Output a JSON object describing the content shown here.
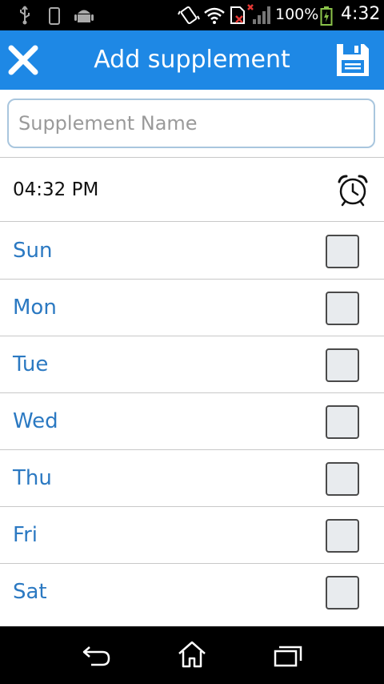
{
  "status_bar": {
    "battery": "100%",
    "time": "4:32"
  },
  "app_bar": {
    "title": "Add supplement"
  },
  "supplement_name": {
    "value": "",
    "placeholder": "Supplement Name"
  },
  "time_row": {
    "time": "04:32 PM"
  },
  "days": [
    {
      "label": "Sun",
      "checked": false
    },
    {
      "label": "Mon",
      "checked": false
    },
    {
      "label": "Tue",
      "checked": false
    },
    {
      "label": "Wed",
      "checked": false
    },
    {
      "label": "Thu",
      "checked": false
    },
    {
      "label": "Fri",
      "checked": false
    },
    {
      "label": "Sat",
      "checked": false
    }
  ],
  "colors": {
    "app_bar": "#1e88e5",
    "day_label": "#2b79c2",
    "status_bar": "#000000"
  }
}
